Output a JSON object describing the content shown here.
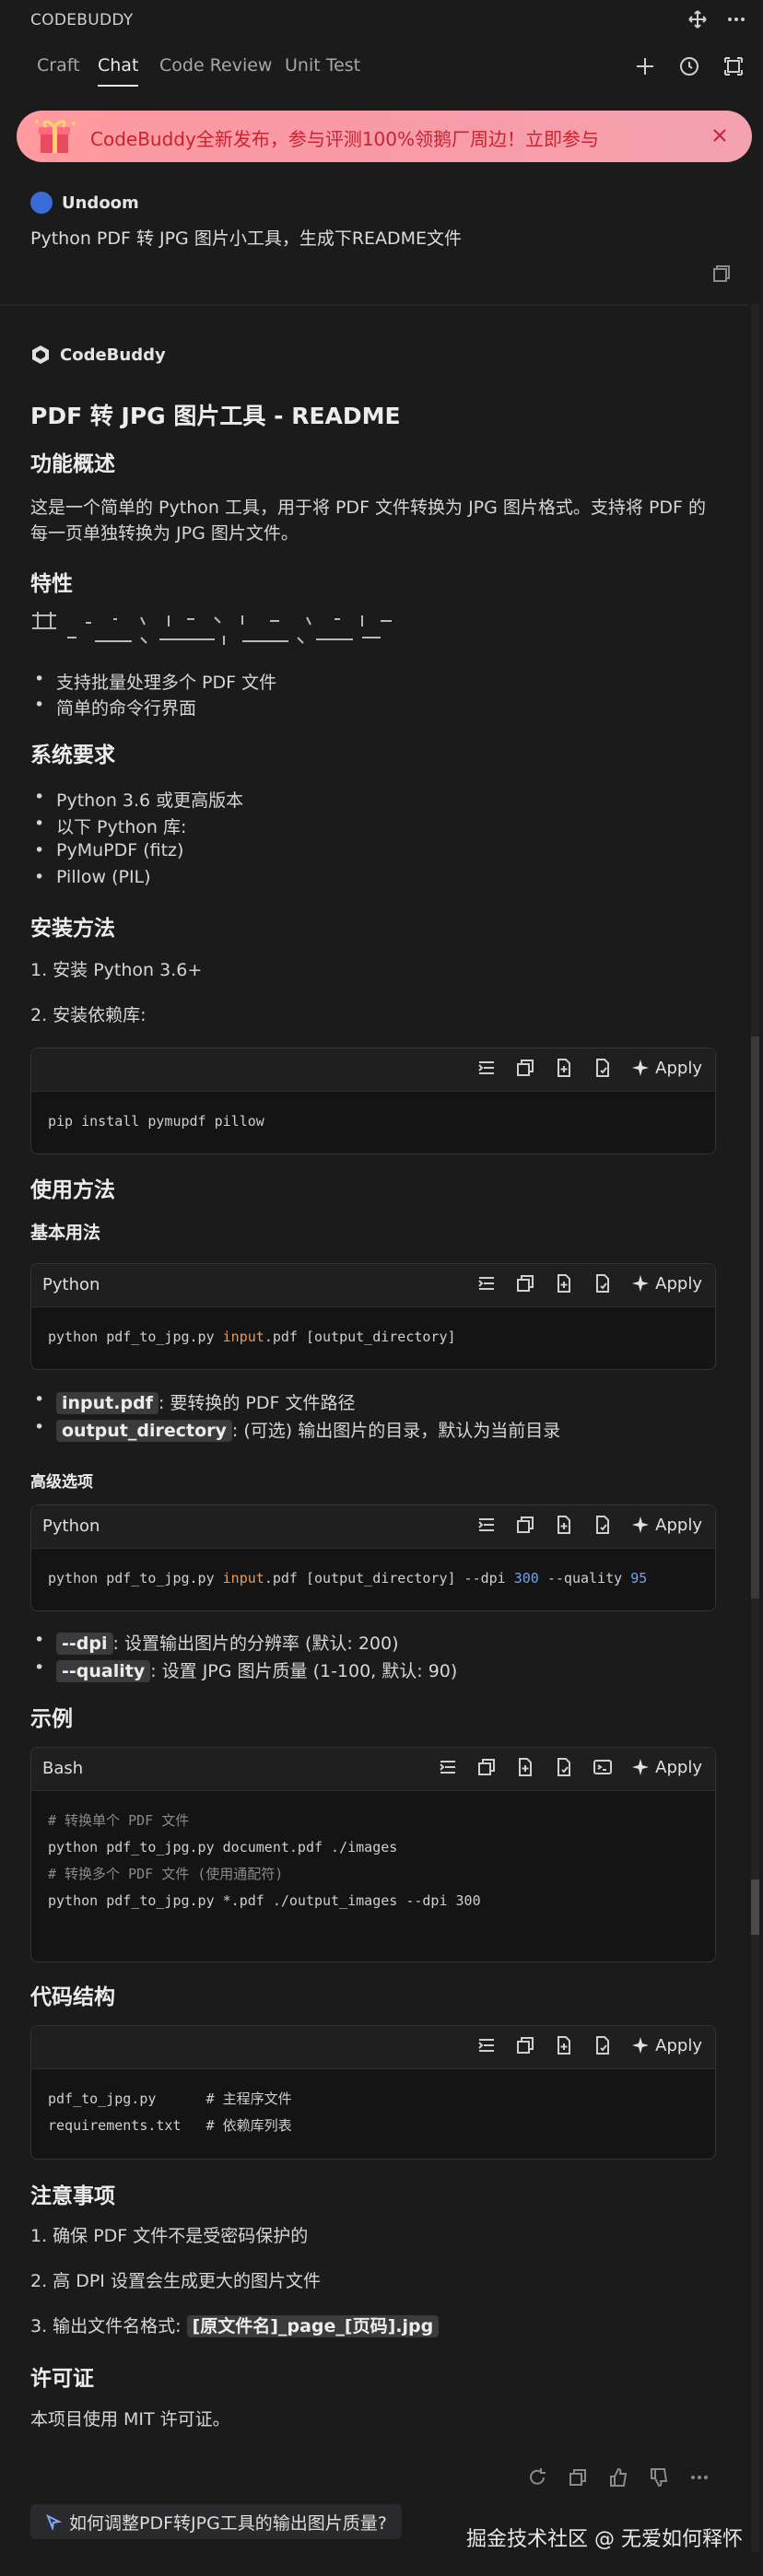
{
  "app": {
    "title": "CODEBUDDY"
  },
  "tabs": [
    {
      "label": "Craft"
    },
    {
      "label": "Chat"
    },
    {
      "label": "Code Review"
    },
    {
      "label": "Unit Test"
    }
  ],
  "banner": {
    "text": "CodeBuddy全新发布，参与评测100%领鹅厂周边！立即参与"
  },
  "user": {
    "name": "Undoom",
    "message": "Python PDF 转 JPG 图片小工具，生成下README文件"
  },
  "bot": {
    "name": "CodeBuddy"
  },
  "doc": {
    "title": "PDF 转 JPG 图片工具 - README",
    "overview_h": "功能概述",
    "overview_p1": "这是一个简单的 Python 工具，用于将 PDF 文件转换为 JPG 图片格式。支持将 PDF 的",
    "overview_p2": "每一页单独转换为 JPG 图片文件。",
    "features_h": "特性",
    "features": [
      "支持批量处理多个 PDF 文件",
      "简单的命令行界面"
    ],
    "req_h": "系统要求",
    "req": [
      "Python 3.6 或更高版本",
      "以下 Python 库:",
      "PyMuPDF (fitz)",
      "Pillow (PIL)"
    ],
    "install_h": "安装方法",
    "install_1": "1. 安装 Python 3.6+",
    "install_2": "2. 安装依赖库:",
    "install_code": "pip install pymupdf pillow",
    "usage_h": "使用方法",
    "basic_h": "基本用法",
    "basic_lang": "Python",
    "basic_code_a": "python pdf_to_jpg.py ",
    "basic_code_b": "input",
    "basic_code_c": ".pdf [output_directory]",
    "basic_items": [
      {
        "code": "input.pdf",
        "text": ": 要转换的 PDF 文件路径"
      },
      {
        "code": "output_directory",
        "text": ": (可选) 输出图片的目录，默认为当前目录"
      }
    ],
    "adv_h": "高级选项",
    "adv_lang": "Python",
    "adv_code_a": "python pdf_to_jpg.py ",
    "adv_code_b": "input",
    "adv_code_c": ".pdf [output_directory] --dpi ",
    "adv_code_d": "300",
    "adv_code_e": " --quality ",
    "adv_code_f": "95",
    "adv_items": [
      {
        "code": "--dpi",
        "text": ": 设置输出图片的分辨率 (默认: 200)"
      },
      {
        "code": "--quality",
        "text": ": 设置 JPG 图片质量 (1-100, 默认: 90)"
      }
    ],
    "example_h": "示例",
    "example_lang": "Bash",
    "example_lines": [
      "# 转换单个 PDF 文件",
      "python pdf_to_jpg.py document.pdf ./images",
      "",
      "# 转换多个 PDF 文件 (使用通配符)",
      "python pdf_to_jpg.py *.pdf ./output_images --dpi 300"
    ],
    "struct_h": "代码结构",
    "struct_lines": [
      "pdf_to_jpg.py      # 主程序文件",
      "requirements.txt   # 依赖库列表"
    ],
    "notes_h": "注意事项",
    "note_1": "1. 确保 PDF 文件不是受密码保护的",
    "note_2": "2. 高 DPI 设置会生成更大的图片文件",
    "note_3_a": "3. 输出文件名格式: ",
    "note_3_b": "[原文件名]_page_[页码].jpg",
    "license_h": "许可证",
    "license_p": "本项目使用 MIT 许可证。"
  },
  "apply_label": "Apply",
  "suggestion": "如何调整PDF转JPG工具的输出图片质量?",
  "watermark": "掘金技术社区 @ 无爱如何释怀"
}
